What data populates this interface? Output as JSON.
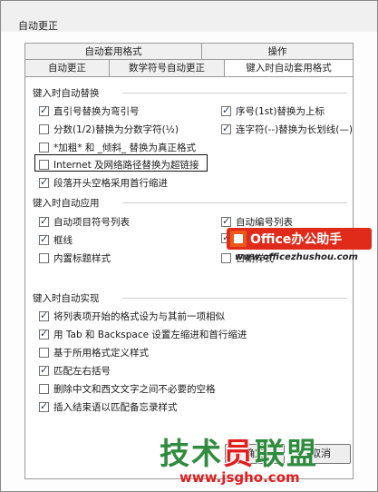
{
  "window": {
    "title": "自动更正"
  },
  "tabs": {
    "row1": [
      {
        "label": "自动套用格式"
      },
      {
        "label": "操作"
      }
    ],
    "row2": [
      {
        "label": "自动更正"
      },
      {
        "label": "数学符号自动更正"
      },
      {
        "label": "键入时自动套用格式"
      }
    ]
  },
  "section_replace": {
    "title": "键入时自动替换",
    "options": [
      {
        "label": "直引号替换为弯引号",
        "checked": true
      },
      {
        "label": "序号(1st)替换为上标",
        "checked": true
      },
      {
        "label": "分数(1/2)替换为分数字符(½)",
        "checked": false
      },
      {
        "label": "连字符(--)替换为长划线(—)",
        "checked": true
      },
      {
        "label": "*加粗* 和 _倾斜_ 替换为真正格式",
        "checked": false
      },
      {
        "label": "Internet 及网络路径替换为超链接",
        "checked": false
      },
      {
        "label": "段落开头空格采用首行缩进",
        "checked": true
      }
    ]
  },
  "section_apply": {
    "title": "键入时自动应用",
    "options": [
      {
        "label": "自动项目符号列表",
        "checked": true
      },
      {
        "label": "自动编号列表",
        "checked": true
      },
      {
        "label": "框线",
        "checked": true
      },
      {
        "label": "",
        "checked": true
      },
      {
        "label": "内置标题样式",
        "checked": false
      },
      {
        "label": "日期样式",
        "checked": false
      }
    ]
  },
  "section_implement": {
    "title": "键入时自动实现",
    "options": [
      {
        "label": "将列表项开始的格式设为与其前一项相似",
        "checked": true
      },
      {
        "label": "用 Tab 和 Backspace 设置左缩进和首行缩进",
        "checked": true
      },
      {
        "label": "基于所用格式定义样式",
        "checked": false
      },
      {
        "label": "匹配左右括号",
        "checked": true
      },
      {
        "label": "删除中文和西文文字之间不必要的空格",
        "checked": false
      },
      {
        "label": "插入结束语以匹配备忘录样式",
        "checked": true
      }
    ]
  },
  "footer": {
    "ok_label": "确定",
    "cancel_label": "取消"
  },
  "brand": {
    "name": "Office办公助手",
    "url": "www.officezhushou.com"
  },
  "watermark": {
    "title_green": "技术",
    "title_red": "员",
    "title_green2": "联盟",
    "url": "www.jsgho.com"
  }
}
